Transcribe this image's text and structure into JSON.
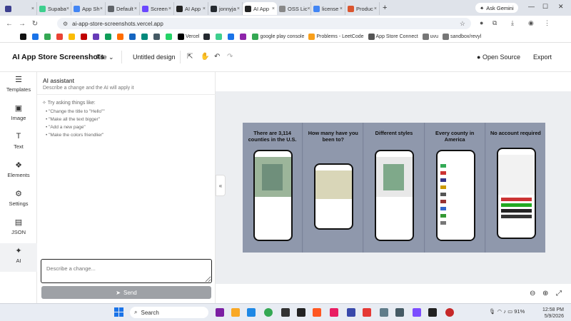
{
  "browser": {
    "tabs": [
      {
        "label": "",
        "color": "#3c3f8f"
      },
      {
        "label": "Supaba",
        "color": "#3ecf8e"
      },
      {
        "label": "App Sh",
        "color": "#4285f4"
      },
      {
        "label": "Default",
        "color": "#5f6368"
      },
      {
        "label": "Screen",
        "color": "#6b48ff"
      },
      {
        "label": "AI App",
        "color": "#222222"
      },
      {
        "label": "jonnyja",
        "color": "#24292f"
      },
      {
        "label": "AI App",
        "color": "#222222"
      },
      {
        "label": "OSS Lic",
        "color": "#888888"
      },
      {
        "label": "license",
        "color": "#4285f4"
      },
      {
        "label": "Produc",
        "color": "#da552f"
      }
    ],
    "active_tab_index": 7,
    "new_tab_label": "+",
    "gemini_label": "Ask Gemini",
    "url": "ai-app-store-screenshots.vercel.app",
    "bookmarks": [
      {
        "label": "",
        "color": "#111111"
      },
      {
        "label": "",
        "color": "#1a73e8"
      },
      {
        "label": "",
        "color": "#34a853"
      },
      {
        "label": "",
        "color": "#ea4335"
      },
      {
        "label": "",
        "color": "#fbbc04"
      },
      {
        "label": "",
        "color": "#c00000"
      },
      {
        "label": "",
        "color": "#673ab7"
      },
      {
        "label": "",
        "color": "#0f9d58"
      },
      {
        "label": "",
        "color": "#ff6d00"
      },
      {
        "label": "",
        "color": "#1565c0"
      },
      {
        "label": "",
        "color": "#00897b"
      },
      {
        "label": "",
        "color": "#455a64"
      },
      {
        "label": "",
        "color": "#25d366"
      },
      {
        "label": "Vercel",
        "color": "#000000"
      },
      {
        "label": "",
        "color": "#24292f"
      },
      {
        "label": "",
        "color": "#3ecf8e"
      },
      {
        "label": "",
        "color": "#1a73e8"
      },
      {
        "label": "",
        "color": "#8e24aa"
      },
      {
        "label": "google play console",
        "color": "#34a853"
      },
      {
        "label": "Problems - LeetCode",
        "color": "#f89f1b"
      },
      {
        "label": "App Store Connect",
        "color": "#555555"
      },
      {
        "label": "uvu",
        "color": "#777777"
      },
      {
        "label": "sandbox/revyl",
        "color": "#777777"
      }
    ]
  },
  "app": {
    "title": "AI App Store Screenshots",
    "file_menu": "File",
    "design_name": "Untitled design",
    "open_source": "Open Source",
    "export": "Export"
  },
  "sidebar": {
    "items": [
      {
        "label": "Templates",
        "icon": "templates-icon",
        "glyph": "☰"
      },
      {
        "label": "Image",
        "icon": "image-icon",
        "glyph": "▣"
      },
      {
        "label": "Text",
        "icon": "text-icon",
        "glyph": "T"
      },
      {
        "label": "Elements",
        "icon": "elements-icon",
        "glyph": "❖"
      },
      {
        "label": "Settings",
        "icon": "gear-icon",
        "glyph": "⚙"
      },
      {
        "label": "JSON",
        "icon": "json-file-icon",
        "glyph": "▤"
      },
      {
        "label": "AI",
        "icon": "sparkles-icon",
        "glyph": "✦"
      }
    ],
    "active_index": 6
  },
  "ai_panel": {
    "heading": "AI assistant",
    "subheading": "Describe a change and the AI will apply it",
    "try_asking": "Try asking things like:",
    "suggestions": [
      "\"Change the title to \"Hello\"\"",
      "\"Make all the text bigger\"",
      "\"Add a new page\"",
      "\"Make the colors friendlier\""
    ],
    "input_placeholder": "Describe a change...",
    "send_label": "Send"
  },
  "canvas": {
    "screenshots": [
      {
        "caption": "There are  3,114 counties in the U.S."
      },
      {
        "caption": "How many have you been to?"
      },
      {
        "caption": "Different styles"
      },
      {
        "caption": "Every county in America"
      },
      {
        "caption": "No account required"
      }
    ],
    "background_color": "#8f98ac",
    "collapse_label": "«"
  },
  "taskbar": {
    "search_label": "Search",
    "battery": "91%",
    "time": "12:58 PM",
    "date": "5/9/2026"
  }
}
